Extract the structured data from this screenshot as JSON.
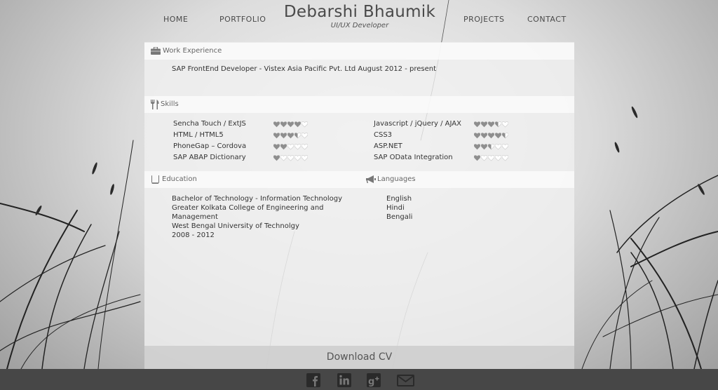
{
  "nav": {
    "home": "HOME",
    "portfolio": "PORTFOLIO",
    "projects": "PROJECTS",
    "contact": "CONTACT"
  },
  "brand": {
    "name": "Debarshi Bhaumik",
    "tagline": "UI/UX Developer"
  },
  "work": {
    "title": "Work Experience",
    "entry": "SAP FrontEnd Developer - Vistex Asia Pacific Pvt. Ltd August 2012 - present"
  },
  "skills": {
    "title": "Skills",
    "items": [
      {
        "name": "Sencha Touch / ExtJS",
        "rating": 4
      },
      {
        "name": "HTML / HTML5",
        "rating": 3.5
      },
      {
        "name": "PhoneGap – Cordova",
        "rating": 2
      },
      {
        "name": "SAP ABAP Dictionary",
        "rating": 1
      },
      {
        "name": "Javascript / jQuery / AJAX",
        "rating": 3.5
      },
      {
        "name": "CSS3",
        "rating": 4.5
      },
      {
        "name": "ASP.NET",
        "rating": 2.5
      },
      {
        "name": "SAP OData Integration",
        "rating": 1
      }
    ]
  },
  "education": {
    "title": "Education",
    "lines": [
      "Bachelor of Technology - Information Technology",
      "Greater Kolkata College of Engineering and",
      "Management",
      "West Bengal University of Technolgy",
      "2008 - 2012"
    ]
  },
  "languages": {
    "title": "Languages",
    "items": [
      "English",
      "Hindi",
      "Bengali"
    ]
  },
  "download_label": "Download CV",
  "footer": {
    "icons": [
      "facebook-icon",
      "linkedin-icon",
      "google-plus-icon",
      "email-icon"
    ]
  },
  "colors": {
    "heart_filled": "#8e8e8e",
    "heart_empty": "#ffffff",
    "footer_bg": "#474747"
  }
}
